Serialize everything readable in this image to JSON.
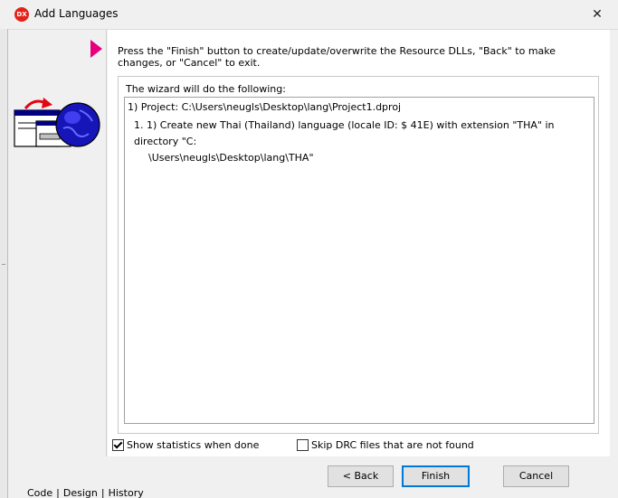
{
  "window": {
    "title": "Add Languages",
    "app_icon_text": "DX",
    "close_glyph": "✕"
  },
  "instructions": "Press the \"Finish\" button to create/update/overwrite the Resource DLLs, \"Back\" to make changes, or \"Cancel\" to exit.",
  "group": {
    "label": "The wizard will do the following:",
    "line1": "1) Project: C:\\Users\\neugls\\Desktop\\lang\\Project1.dproj",
    "line2": "1. 1) Create new Thai (Thailand) language (locale ID: $    41E) with extension \"THA\" in directory \"C:",
    "line3": "\\Users\\neugls\\Desktop\\lang\\THA\""
  },
  "options": {
    "show_statistics": {
      "label": "Show statistics when done",
      "checked": true
    },
    "skip_drc": {
      "label": "Skip DRC files that are not found",
      "checked": false
    }
  },
  "buttons": {
    "back": "< Back",
    "finish": "Finish",
    "cancel": "Cancel"
  },
  "bg_tabs": [
    "Code",
    "Design",
    "History"
  ],
  "colors": {
    "accent_arrow": "#e6007e",
    "default_button_border": "#0078d7",
    "app_icon": "#e2231a"
  },
  "icons": {
    "app": "delphi-dx-icon",
    "arrow": "pink-triangle-arrow-icon",
    "wizard": "window-globe-translate-icon",
    "close": "close-icon"
  }
}
